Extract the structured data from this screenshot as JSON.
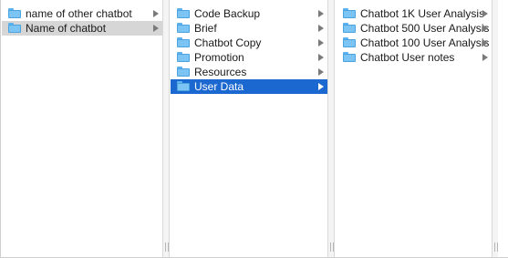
{
  "columns": [
    {
      "items": [
        {
          "label": "name of other chatbot",
          "icon": "folder-icon",
          "has_children": true,
          "state": "normal"
        },
        {
          "label": "Name of chatbot",
          "icon": "folder-icon",
          "has_children": true,
          "state": "selected-inactive"
        }
      ]
    },
    {
      "items": [
        {
          "label": "Code Backup",
          "icon": "folder-icon",
          "has_children": true,
          "state": "normal"
        },
        {
          "label": "Brief",
          "icon": "folder-icon",
          "has_children": true,
          "state": "normal"
        },
        {
          "label": "Chatbot Copy",
          "icon": "folder-icon",
          "has_children": true,
          "state": "normal"
        },
        {
          "label": "Promotion",
          "icon": "folder-icon",
          "has_children": true,
          "state": "normal"
        },
        {
          "label": "Resources",
          "icon": "folder-icon",
          "has_children": true,
          "state": "normal"
        },
        {
          "label": "User Data",
          "icon": "folder-icon",
          "has_children": true,
          "state": "selected-active"
        }
      ]
    },
    {
      "items": [
        {
          "label": "Chatbot 1K User Analysis",
          "icon": "folder-icon",
          "has_children": true,
          "state": "normal"
        },
        {
          "label": "Chatbot 500 User Analysis",
          "icon": "folder-icon",
          "has_children": true,
          "state": "normal"
        },
        {
          "label": "Chatbot 100 User Analysis",
          "icon": "folder-icon",
          "has_children": true,
          "state": "normal"
        },
        {
          "label": "Chatbot User notes",
          "icon": "folder-icon",
          "has_children": true,
          "state": "normal"
        }
      ]
    }
  ],
  "colors": {
    "selection_active": "#1b68d0",
    "selection_inactive": "#d6d6d6",
    "folder": "#7cc4f3"
  }
}
